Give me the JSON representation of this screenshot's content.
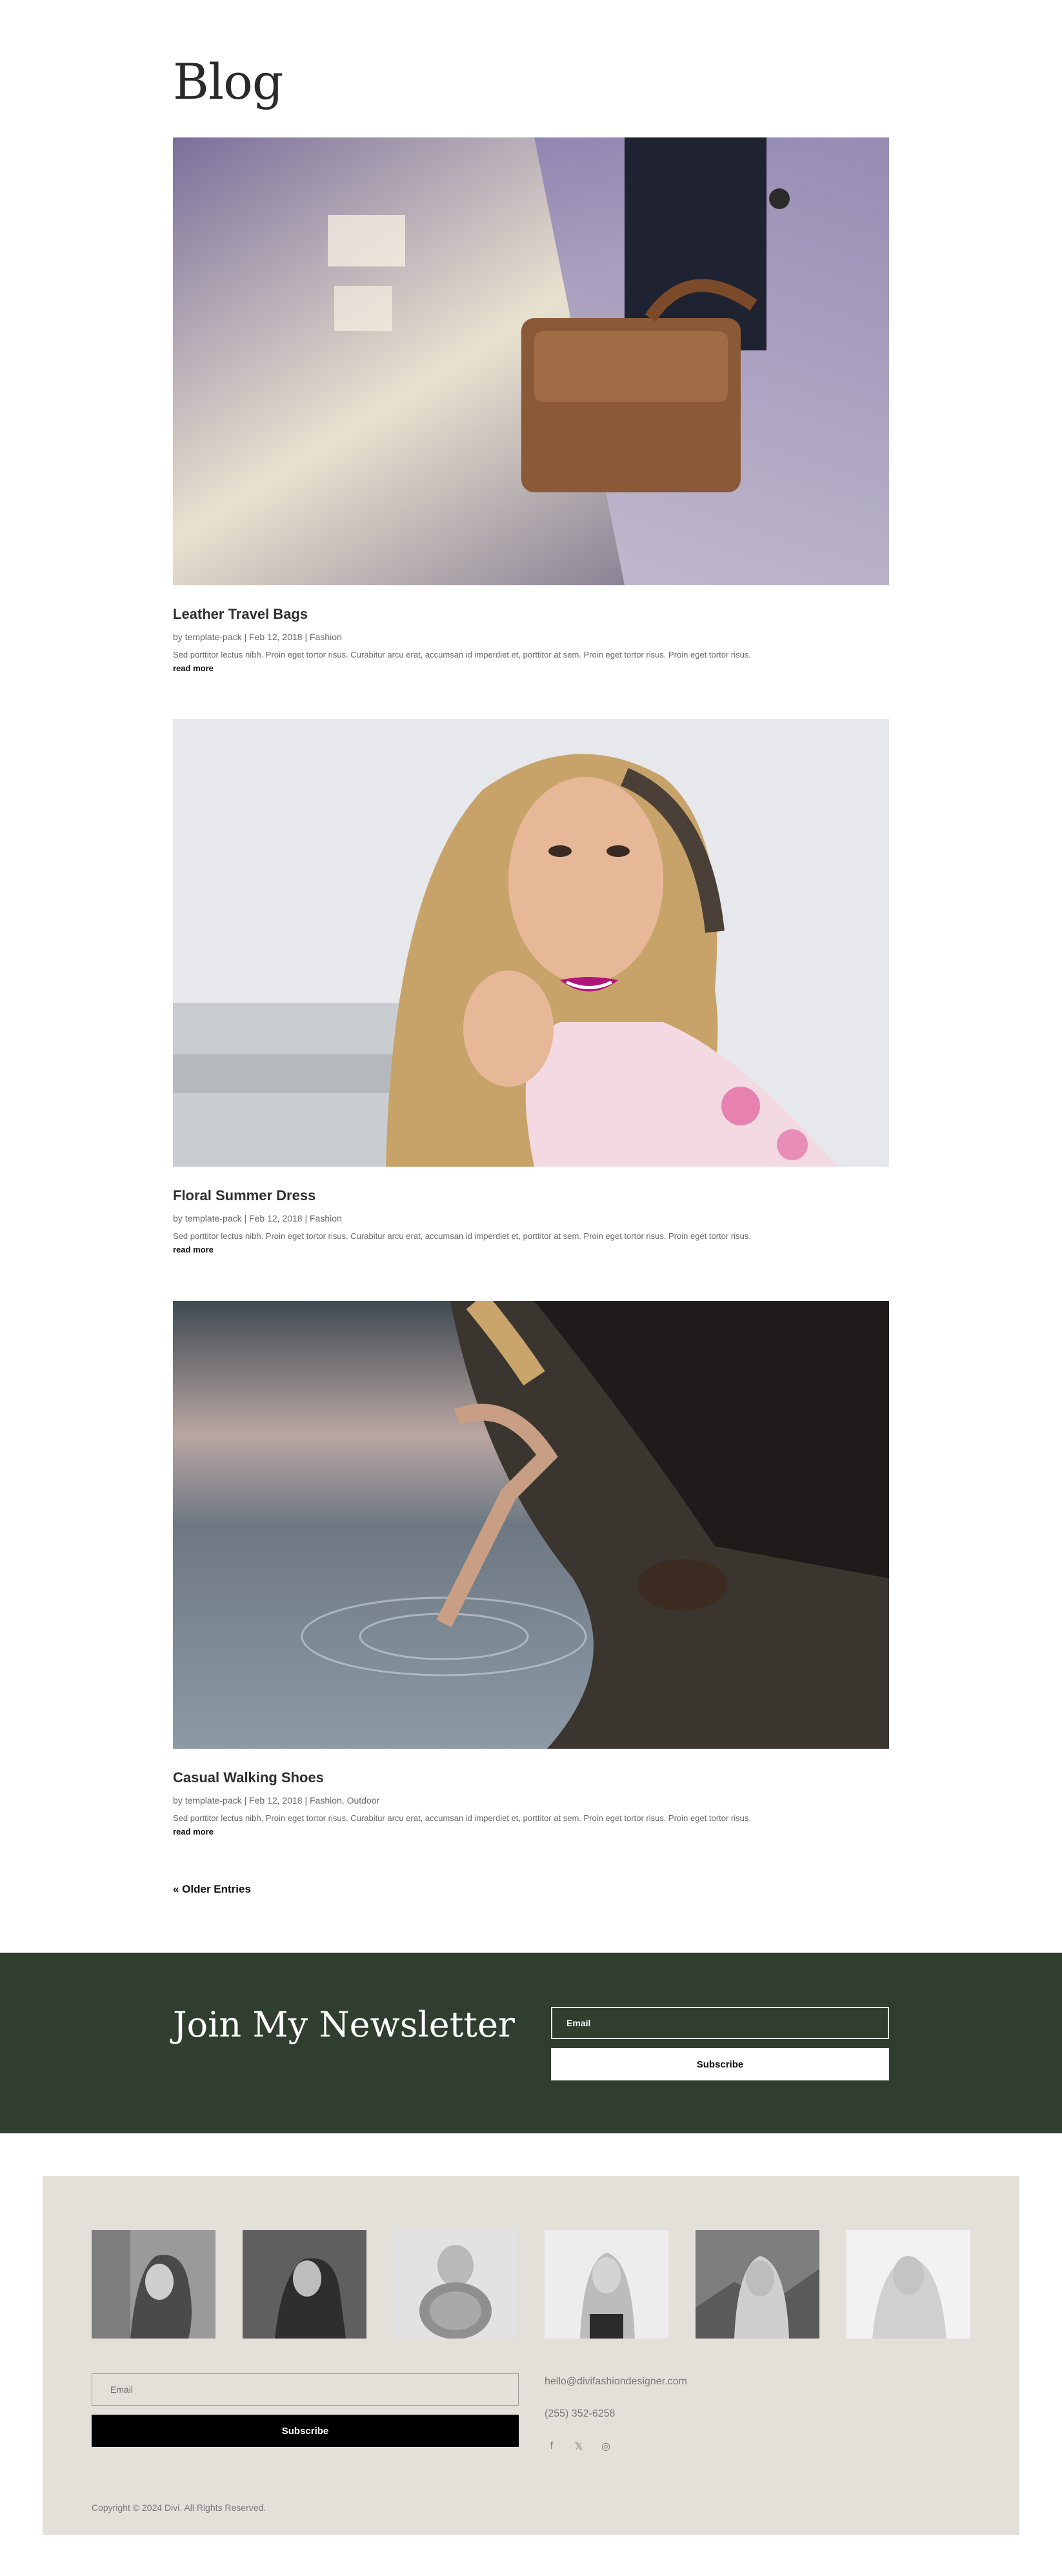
{
  "page": {
    "title": "Blog"
  },
  "posts": [
    {
      "title": "Leather Travel Bags",
      "author_prefix": "by ",
      "author": "template-pack",
      "date": "Feb 12, 2018",
      "categories": "Fashion",
      "excerpt": "Sed porttitor lectus nibh. Proin eget tortor risus. Curabitur arcu erat, accumsan id imperdiet et, porttitor at sem. Proin eget tortor risus. Proin eget tortor risus.",
      "read_more": "read more",
      "image": "leather-bag-photo"
    },
    {
      "title": "Floral Summer Dress",
      "author_prefix": "by ",
      "author": "template-pack",
      "date": "Feb 12, 2018",
      "categories": "Fashion",
      "excerpt": "Sed porttitor lectus nibh. Proin eget tortor risus. Curabitur arcu erat, accumsan id imperdiet et, porttitor at sem. Proin eget tortor risus. Proin eget tortor risus.",
      "read_more": "read more",
      "image": "smiling-woman-photo"
    },
    {
      "title": "Casual Walking Shoes",
      "author_prefix": "by ",
      "author": "template-pack",
      "date": "Feb 12, 2018",
      "categories": "Fashion, Outdoor",
      "excerpt": "Sed porttitor lectus nibh. Proin eget tortor risus. Curabitur arcu erat, accumsan id imperdiet et, porttitor at sem. Proin eget tortor risus. Proin eget tortor risus.",
      "read_more": "read more",
      "image": "woman-by-water-photo"
    }
  ],
  "pagination": {
    "older_entries": "« Older Entries"
  },
  "newsletter": {
    "title": "Join My Newsletter",
    "email_placeholder": "Email",
    "subscribe_label": "Subscribe",
    "background": "#2f3e2e"
  },
  "footer": {
    "email_placeholder": "Email",
    "subscribe_label": "Subscribe",
    "contact_email": "hello@divifashiondesigner.com",
    "contact_phone": "(255) 352-6258",
    "socials": [
      {
        "name": "facebook-icon",
        "glyph": "f"
      },
      {
        "name": "x-twitter-icon",
        "glyph": "𝕏"
      },
      {
        "name": "instagram-icon",
        "glyph": "◎"
      }
    ],
    "copyright": "Copyright © 2024 Divi. All Rights Reserved.",
    "background": "#e3e0da"
  }
}
